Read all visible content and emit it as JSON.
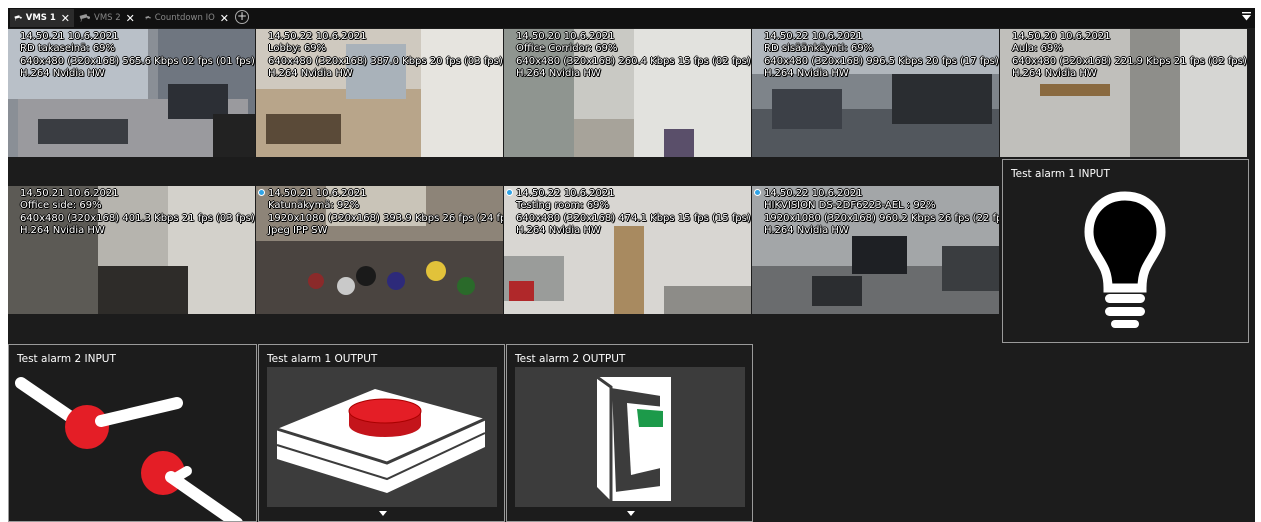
{
  "tabs": [
    {
      "label": "VMS 1",
      "active": true,
      "icon": "camera-icon",
      "close": "✕"
    },
    {
      "label": "VMS 2",
      "active": false,
      "icon": "camera-icon",
      "close": "✕"
    },
    {
      "label": "Countdown IO",
      "active": false,
      "icon": "camera-icon",
      "close": "✕"
    }
  ],
  "add_tab": {
    "label": "+",
    "icon": "add-tab-icon"
  },
  "menu_icon": "menu-dropdown-icon",
  "cameras": [
    {
      "lines": [
        "14.50.21  10.6.2021",
        "RD takaseinä: 69%",
        "640x480 (320x168) 565.6 Kbps 02 fps (01 fps)",
        "H.264 Nvidia HW"
      ],
      "live": false
    },
    {
      "lines": [
        "14.50.22  10.6.2021",
        "Lobby: 69%",
        "640x480 (320x168) 387.0 Kbps 20 fps (03 fps)",
        "H.264 Nvidia HW"
      ],
      "live": false
    },
    {
      "lines": [
        "14.50.20  10.6.2021",
        "Office Corridor: 69%",
        "640x480 (320x168) 260.4 Kbps 15 fps (02 fps)",
        "H.264 Nvidia HW"
      ],
      "live": false
    },
    {
      "lines": [
        "14.50.22  10.6.2021",
        "RD sisäänkäynti: 69%",
        "640x480 (320x168) 996.5 Kbps 20 fps (17 fps)",
        "H.264 Nvidia HW"
      ],
      "live": false
    },
    {
      "lines": [
        "14.50.20  10.6.2021",
        "Aula: 69%",
        "640x480 (320x168) 221.9 Kbps 21 fps (02 fps)",
        "H.264 Nvidia HW"
      ],
      "live": false
    },
    {
      "lines": [
        "14.50.21  10.6.2021",
        "Office side: 69%",
        "640x480 (320x168) 401.3 Kbps 21 fps (03 fps)",
        "H.264 Nvidia HW"
      ],
      "live": false
    },
    {
      "lines": [
        "14.50.21  10.6.2021",
        "Katunäkymä: 92%",
        "1920x1080 (320x168) 393.9 Kbps 26 fps (24 fps)",
        "Jpeg IPP SW"
      ],
      "live": true
    },
    {
      "lines": [
        "14.50.22  10.6.2021",
        "Testing room: 69%",
        "640x480 (320x168) 474.1 Kbps 15 fps (15 fps)",
        "H.264 Nvidia HW"
      ],
      "live": true
    },
    {
      "lines": [
        "14.50.22  10.6.2021",
        "HIKVISION DS-2DF6223-AEL : 92%",
        "1920x1080 (320x168) 960.2 Kbps 26 fps (22 fps)",
        "H.264 Nvidia HW"
      ],
      "live": true
    }
  ],
  "alarms": [
    {
      "title": "Test alarm 1 INPUT",
      "icon": "lightbulb-icon"
    },
    {
      "title": "Test alarm 2 INPUT",
      "icon": "switch-levers-icon"
    },
    {
      "title": "Test alarm 1 OUTPUT",
      "icon": "red-push-button-icon"
    },
    {
      "title": "Test alarm 2 OUTPUT",
      "icon": "wall-switch-icon"
    }
  ],
  "colors": {
    "background": "#1c1c1c",
    "tabbar": "#111111",
    "accent_red": "#e41e26",
    "live_dot": "#2fa4e7",
    "switch_green": "#1c9a4a"
  }
}
